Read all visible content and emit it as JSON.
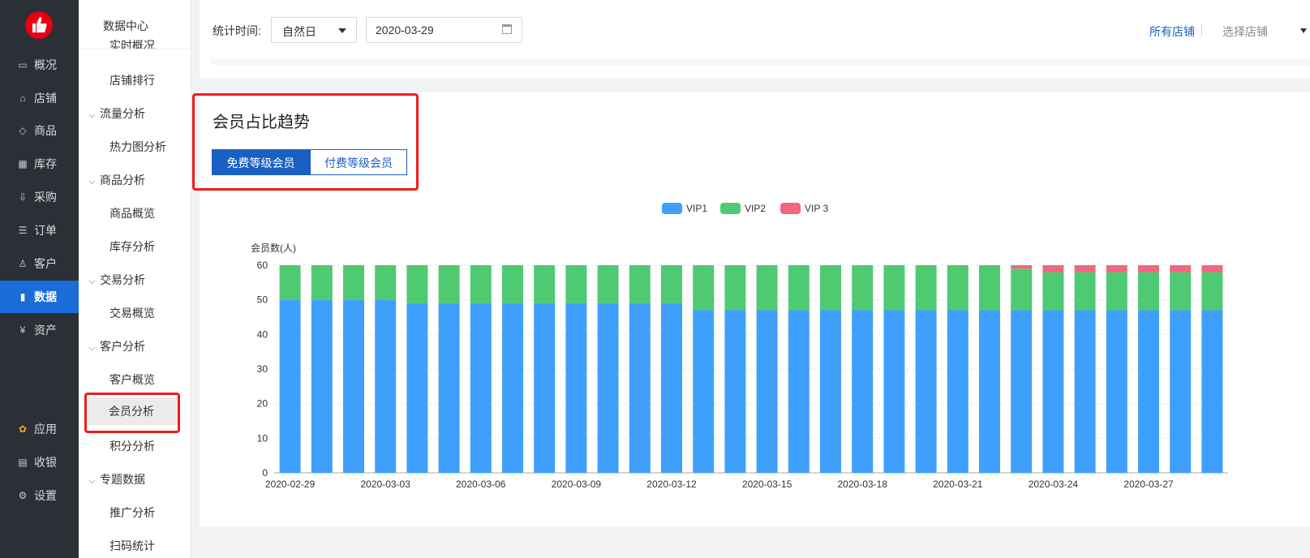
{
  "nav": {
    "items": [
      {
        "label": "概况",
        "icon": "monitor-icon"
      },
      {
        "label": "店铺",
        "icon": "store-icon"
      },
      {
        "label": "商品",
        "icon": "tag-icon"
      },
      {
        "label": "库存",
        "icon": "building-icon"
      },
      {
        "label": "采购",
        "icon": "download-box-icon"
      },
      {
        "label": "订单",
        "icon": "list-icon"
      },
      {
        "label": "客户",
        "icon": "user-icon"
      },
      {
        "label": "数据",
        "icon": "bar-chart-icon"
      },
      {
        "label": "资产",
        "icon": "yen-icon"
      }
    ],
    "bottom_items": [
      {
        "label": "应用",
        "icon": "apps-icon"
      },
      {
        "label": "收银",
        "icon": "cashier-icon"
      },
      {
        "label": "设置",
        "icon": "gear-icon"
      }
    ]
  },
  "submenu": {
    "title": "数据中心",
    "clipped_label": "实时概况",
    "entries": [
      {
        "type": "item",
        "label": "店铺排行"
      },
      {
        "type": "group",
        "label": "流量分析"
      },
      {
        "type": "item",
        "label": "热力图分析"
      },
      {
        "type": "group",
        "label": "商品分析"
      },
      {
        "type": "item",
        "label": "商品概览"
      },
      {
        "type": "item",
        "label": "库存分析"
      },
      {
        "type": "group",
        "label": "交易分析"
      },
      {
        "type": "item",
        "label": "交易概览"
      },
      {
        "type": "group",
        "label": "客户分析"
      },
      {
        "type": "item",
        "label": "客户概览"
      },
      {
        "type": "item",
        "label": "会员分析"
      },
      {
        "type": "item",
        "label": "积分分析"
      },
      {
        "type": "group",
        "label": "专题数据"
      },
      {
        "type": "item",
        "label": "推广分析"
      },
      {
        "type": "item",
        "label": "扫码统计"
      }
    ]
  },
  "filter": {
    "time_label": "统计时间:",
    "period_value": "自然日",
    "date_value": "2020-03-29",
    "all_stores": "所有店铺",
    "select_store": "选择店铺"
  },
  "card": {
    "title": "会员占比趋势",
    "tab_free": "免费等级会员",
    "tab_paid": "付费等级会员"
  },
  "chart_data": {
    "type": "bar",
    "stacked": true,
    "ylabel": "会员数(人)",
    "ylim": [
      0,
      60
    ],
    "yticks": [
      0,
      10,
      20,
      30,
      40,
      50,
      60
    ],
    "legend_position": "top-center",
    "categories": [
      "2020-02-29",
      "2020-03-01",
      "2020-03-02",
      "2020-03-03",
      "2020-03-04",
      "2020-03-05",
      "2020-03-06",
      "2020-03-07",
      "2020-03-08",
      "2020-03-09",
      "2020-03-10",
      "2020-03-11",
      "2020-03-12",
      "2020-03-13",
      "2020-03-14",
      "2020-03-15",
      "2020-03-16",
      "2020-03-17",
      "2020-03-18",
      "2020-03-19",
      "2020-03-20",
      "2020-03-21",
      "2020-03-22",
      "2020-03-23",
      "2020-03-24",
      "2020-03-25",
      "2020-03-26",
      "2020-03-27",
      "2020-03-28",
      "2020-03-29"
    ],
    "xtick_labels": [
      "2020-02-29",
      "2020-03-03",
      "2020-03-06",
      "2020-03-09",
      "2020-03-12",
      "2020-03-15",
      "2020-03-18",
      "2020-03-21",
      "2020-03-24",
      "2020-03-27"
    ],
    "series": [
      {
        "name": "VIP1",
        "color": "#3fa0fc",
        "values": [
          50,
          50,
          50,
          50,
          49,
          49,
          49,
          49,
          49,
          49,
          49,
          49,
          49,
          47,
          47,
          47,
          47,
          47,
          47,
          47,
          47,
          47,
          47,
          47,
          47,
          47,
          47,
          47,
          47,
          47
        ]
      },
      {
        "name": "VIP2",
        "color": "#4fca72",
        "values": [
          10,
          10,
          10,
          10,
          11,
          11,
          11,
          11,
          11,
          11,
          11,
          11,
          11,
          13,
          13,
          13,
          13,
          13,
          13,
          13,
          13,
          13,
          13,
          12,
          11,
          11,
          11,
          11,
          11,
          11
        ]
      },
      {
        "name": "VIP 3",
        "color": "#f4657e",
        "values": [
          0,
          0,
          0,
          0,
          0,
          0,
          0,
          0,
          0,
          0,
          0,
          0,
          0,
          0,
          0,
          0,
          0,
          0,
          0,
          0,
          0,
          0,
          0,
          1,
          2,
          2,
          2,
          2,
          2,
          2
        ]
      }
    ]
  }
}
